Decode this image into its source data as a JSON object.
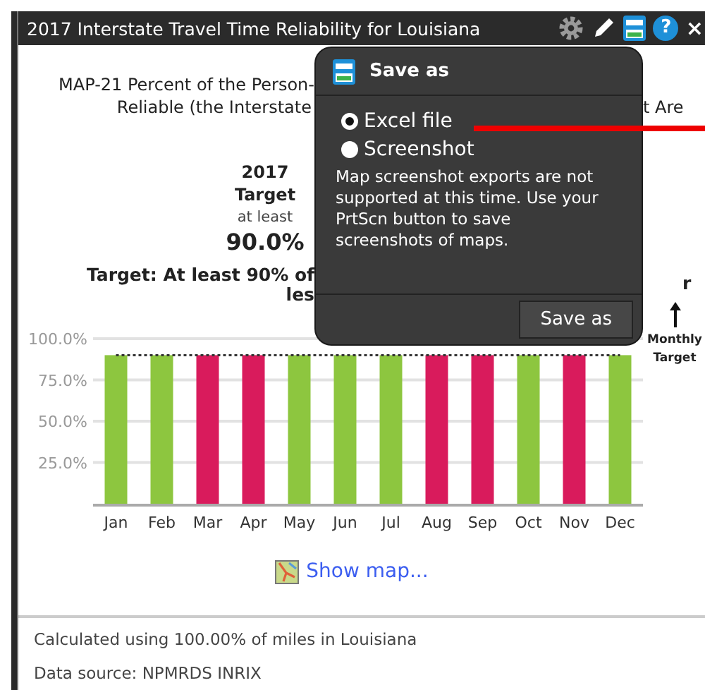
{
  "window": {
    "title": "2017 Interstate Travel Time Reliability for Louisiana",
    "toolbar": {
      "help": "?",
      "close": "×"
    }
  },
  "report": {
    "subtitle_left": [
      "MAP-21 Percent of the Person-",
      "Reliable (the Interstate"
    ],
    "subtitle_right": "t Are",
    "year": "2017",
    "target_label": "Target",
    "target_qualifier": "at least",
    "target_value": "90.0%",
    "target_sentence": [
      "Target: At least 90% of",
      "les"
    ],
    "target_sentence_right": "r",
    "chart_data": {
      "type": "bar",
      "categories": [
        "Jan",
        "Feb",
        "Mar",
        "Apr",
        "May",
        "Jun",
        "Jul",
        "Aug",
        "Sep",
        "Oct",
        "Nov",
        "Dec"
      ],
      "ylim": [
        0,
        100
      ],
      "stacked": true,
      "yticks": [
        {
          "value": 25,
          "label": "25.0%"
        },
        {
          "value": 50,
          "label": "50.0%"
        },
        {
          "value": 75,
          "label": "75.0%"
        },
        {
          "value": 100,
          "label": "100.0%"
        }
      ],
      "series": [
        {
          "color": "#8dc63f",
          "values": [
            90,
            90,
            null,
            null,
            90,
            90,
            90,
            null,
            null,
            90,
            null,
            90
          ]
        },
        {
          "color": "#d91b5c",
          "values": [
            null,
            null,
            90,
            90,
            null,
            null,
            null,
            90,
            90,
            null,
            90,
            null
          ]
        },
        {
          "name": "Monthly Target",
          "type": "line",
          "line_style": "dotted",
          "color": "#333333",
          "values": [
            90,
            90,
            90,
            90,
            90,
            90,
            90,
            90,
            90,
            90,
            90,
            90
          ]
        }
      ],
      "grid": true
    },
    "map_link": "Show map...",
    "footer": [
      "Calculated using 100.00% of miles in Louisiana",
      "Data source: NPMRDS INRIX"
    ]
  },
  "save_dialog": {
    "title": "Save as",
    "options": [
      {
        "label": "Excel file",
        "selected": true
      },
      {
        "label": "Screenshot",
        "selected": false
      }
    ],
    "note": "Map screenshot exports are not supported at this time. Use your PrtScn button to save screenshots of maps.",
    "button": "Save as"
  }
}
